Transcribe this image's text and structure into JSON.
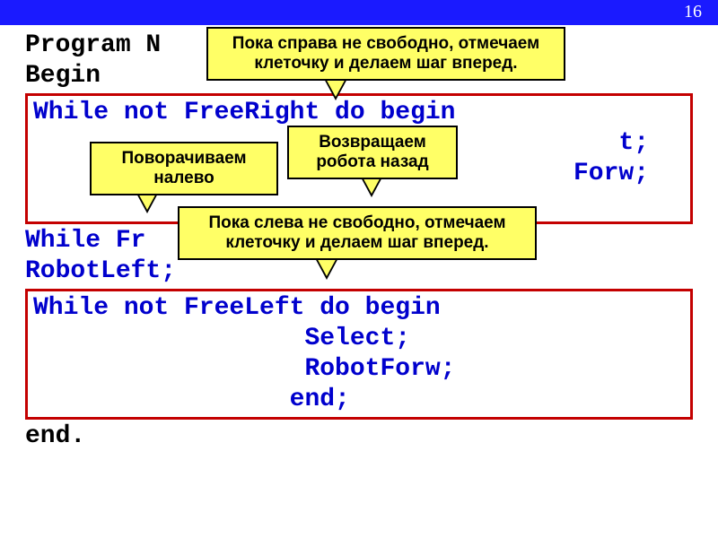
{
  "page_number": "16",
  "code": {
    "l1a": "Program",
    "l1b": " N",
    "l2": "Begin",
    "box1_l1": "While not FreeRight do begin",
    "box1_l2_suffix": "t;",
    "box1_l3_suffix": "Forw;",
    "mid1": "While Fr",
    "mid2": "RobotLeft;",
    "box2_l1": "While not FreeLeft do begin",
    "box2_l2": "                  Select;",
    "box2_l3": "                  RobotForw;",
    "box2_l4": "                 end;",
    "last": "end."
  },
  "callouts": {
    "c1": "Пока справа не свободно, отмечаем клеточку и делаем шаг вперед.",
    "c2": "Возвращаем робота назад",
    "c3": "Поворачиваем налево",
    "c4": "Пока слева не свободно, отмечаем клеточку и делаем шаг вперед."
  }
}
